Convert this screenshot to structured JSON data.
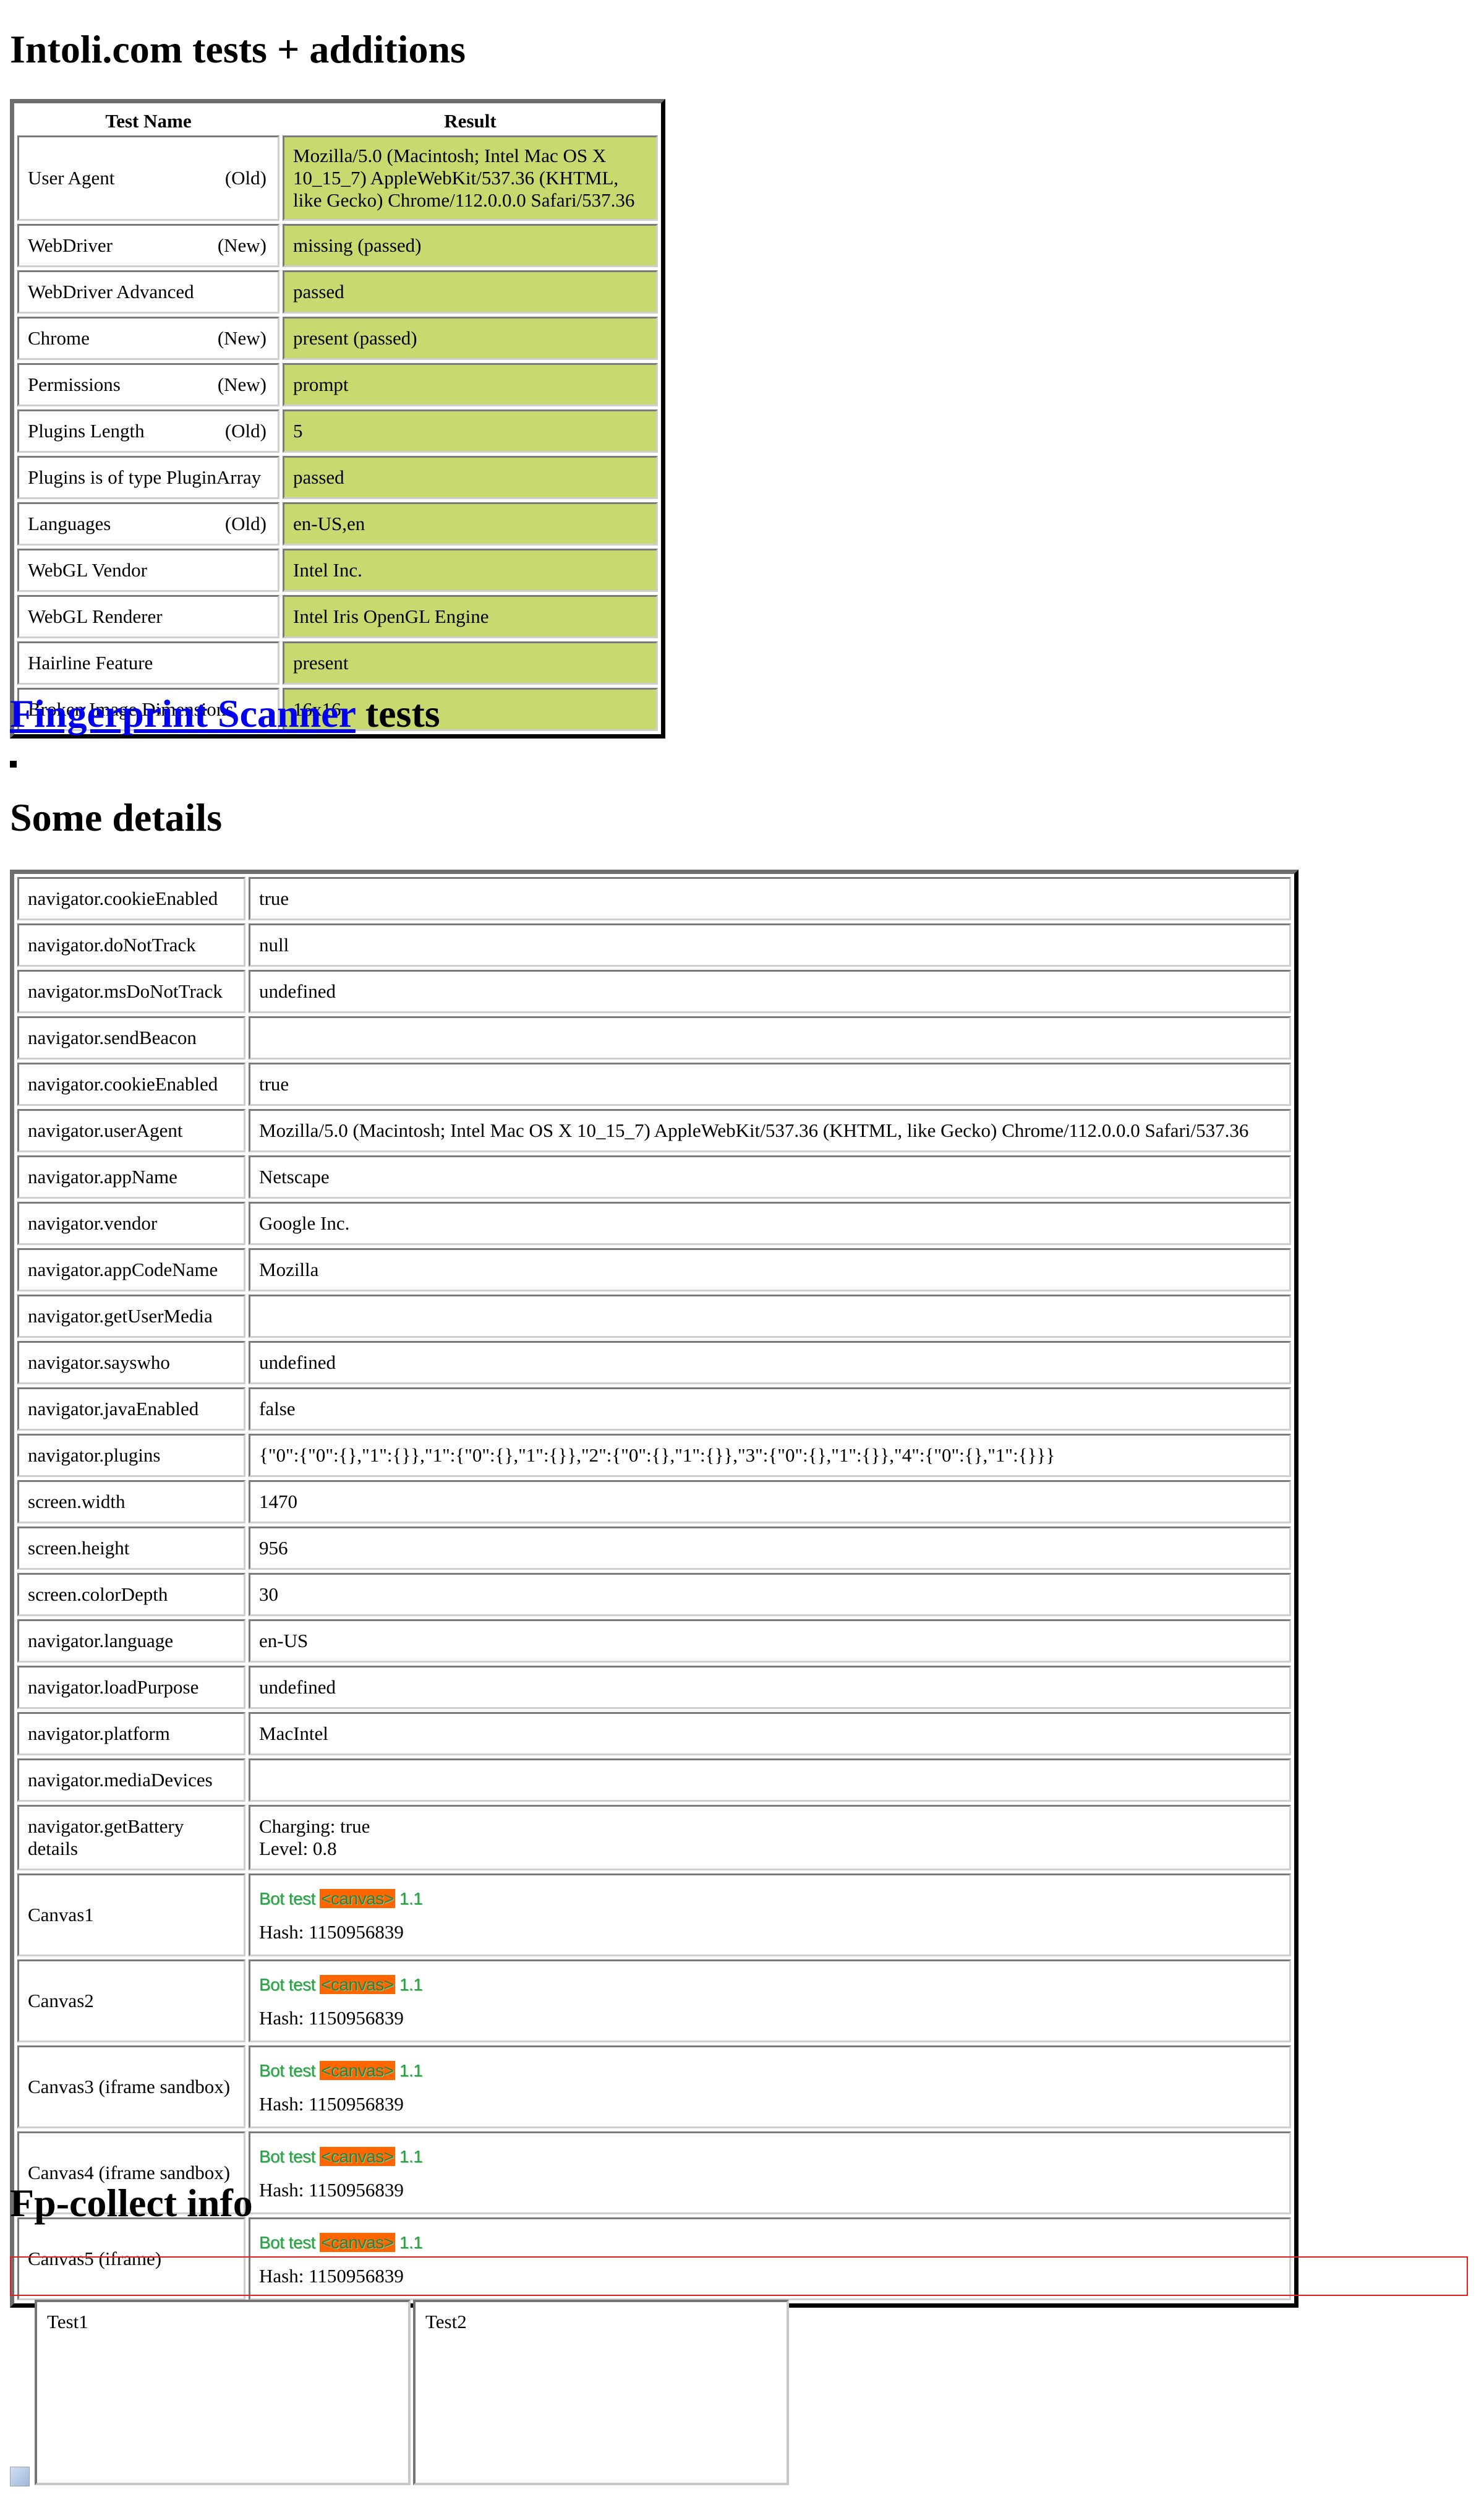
{
  "headings": {
    "intoli": "Intoli.com tests + additions",
    "fp_link": "Fingerprint Scanner",
    "fp_suffix": " tests",
    "details": "Some details",
    "fpcollect": "Fp-collect info"
  },
  "intoli_table": {
    "columns": [
      "Test Name",
      "Result"
    ],
    "rows": [
      {
        "name": "User Agent",
        "tag": "(Old)",
        "result": "Mozilla/5.0 (Macintosh; Intel Mac OS X 10_15_7) AppleWebKit/537.36 (KHTML, like Gecko) Chrome/112.0.0.0 Safari/537.36"
      },
      {
        "name": "WebDriver",
        "tag": "(New)",
        "result": "missing (passed)"
      },
      {
        "name": "WebDriver Advanced",
        "tag": "",
        "result": "passed"
      },
      {
        "name": "Chrome",
        "tag": "(New)",
        "result": "present (passed)"
      },
      {
        "name": "Permissions",
        "tag": "(New)",
        "result": "prompt"
      },
      {
        "name": "Plugins Length",
        "tag": "(Old)",
        "result": "5"
      },
      {
        "name": "Plugins is of type PluginArray",
        "tag": "",
        "result": "passed"
      },
      {
        "name": "Languages",
        "tag": "(Old)",
        "result": "en-US,en"
      },
      {
        "name": "WebGL Vendor",
        "tag": "",
        "result": "Intel Inc."
      },
      {
        "name": "WebGL Renderer",
        "tag": "",
        "result": "Intel Iris OpenGL Engine"
      },
      {
        "name": "Hairline Feature",
        "tag": "",
        "result": "present"
      },
      {
        "name": "Broken Image Dimensions",
        "tag": "",
        "result": "16x16"
      }
    ],
    "pass_color": "#c8d96f"
  },
  "details_table": {
    "rows": [
      {
        "name": "navigator.cookieEnabled",
        "value": "true"
      },
      {
        "name": "navigator.doNotTrack",
        "value": "null"
      },
      {
        "name": "navigator.msDoNotTrack",
        "value": "undefined"
      },
      {
        "name": "navigator.sendBeacon",
        "value": ""
      },
      {
        "name": "navigator.cookieEnabled",
        "value": "true"
      },
      {
        "name": "navigator.userAgent",
        "value": "Mozilla/5.0 (Macintosh; Intel Mac OS X 10_15_7) AppleWebKit/537.36 (KHTML, like Gecko) Chrome/112.0.0.0 Safari/537.36"
      },
      {
        "name": "navigator.appName",
        "value": "Netscape"
      },
      {
        "name": "navigator.vendor",
        "value": "Google Inc."
      },
      {
        "name": "navigator.appCodeName",
        "value": "Mozilla"
      },
      {
        "name": "navigator.getUserMedia",
        "value": ""
      },
      {
        "name": "navigator.sayswho",
        "value": "undefined"
      },
      {
        "name": "navigator.javaEnabled",
        "value": "false"
      },
      {
        "name": "navigator.plugins",
        "value": "{\"0\":{\"0\":{},\"1\":{}},\"1\":{\"0\":{},\"1\":{}},\"2\":{\"0\":{},\"1\":{}},\"3\":{\"0\":{},\"1\":{}},\"4\":{\"0\":{},\"1\":{}}}"
      },
      {
        "name": "screen.width",
        "value": "1470"
      },
      {
        "name": "screen.height",
        "value": "956"
      },
      {
        "name": "screen.colorDepth",
        "value": "30"
      },
      {
        "name": "navigator.language",
        "value": "en-US"
      },
      {
        "name": "navigator.loadPurpose",
        "value": "undefined"
      },
      {
        "name": "navigator.platform",
        "value": "MacIntel"
      },
      {
        "name": "navigator.mediaDevices",
        "value": ""
      }
    ],
    "battery": {
      "name": "navigator.getBattery details",
      "charging": "Charging: true",
      "level": "Level: 0.8"
    },
    "canvases": [
      {
        "name": "Canvas1",
        "hash": "Hash: 1150956839"
      },
      {
        "name": "Canvas2",
        "hash": "Hash: 1150956839"
      },
      {
        "name": "Canvas3 (iframe sandbox)",
        "hash": "Hash: 1150956839"
      },
      {
        "name": "Canvas4 (iframe sandbox)",
        "hash": "Hash: 1150956839"
      },
      {
        "name": "Canvas5 (iframe)",
        "hash": "Hash: 1150956839"
      }
    ],
    "canvas_art": {
      "pre": "Bot test ",
      "tag": "<canvas>",
      "post": " 1.1"
    }
  },
  "frames": {
    "left": "Test1",
    "right": "Test2"
  }
}
